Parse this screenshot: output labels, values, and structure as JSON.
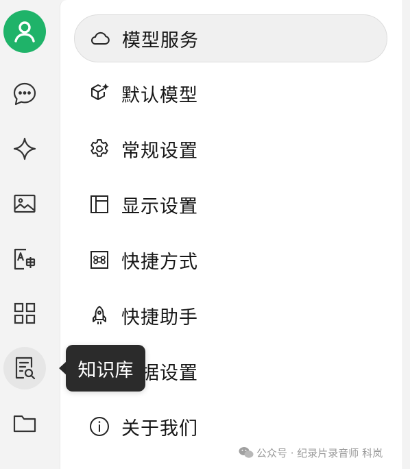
{
  "sidebar": {
    "avatar_icon": "user-icon",
    "accent_color": "#1fb369",
    "items": [
      {
        "icon": "chat-icon"
      },
      {
        "icon": "sparkle-icon"
      },
      {
        "icon": "image-icon"
      },
      {
        "icon": "translate-icon"
      },
      {
        "icon": "apps-grid-icon"
      },
      {
        "icon": "knowledge-base-icon",
        "active": true
      },
      {
        "icon": "folder-icon"
      }
    ]
  },
  "settings_menu": {
    "items": [
      {
        "label": "模型服务",
        "icon": "cloud-icon",
        "selected": true
      },
      {
        "label": "默认模型",
        "icon": "cube-sparkle-icon"
      },
      {
        "label": "常规设置",
        "icon": "gear-icon"
      },
      {
        "label": "显示设置",
        "icon": "layout-icon"
      },
      {
        "label": "快捷方式",
        "icon": "command-key-icon"
      },
      {
        "label": "快捷助手",
        "icon": "rocket-icon"
      },
      {
        "label": "数据设置",
        "icon": "database-icon"
      },
      {
        "label": "关于我们",
        "icon": "info-icon"
      }
    ]
  },
  "tooltip": {
    "text": "知识库"
  },
  "watermark": {
    "text": "公众号 · 纪录片录音师 科岚"
  }
}
